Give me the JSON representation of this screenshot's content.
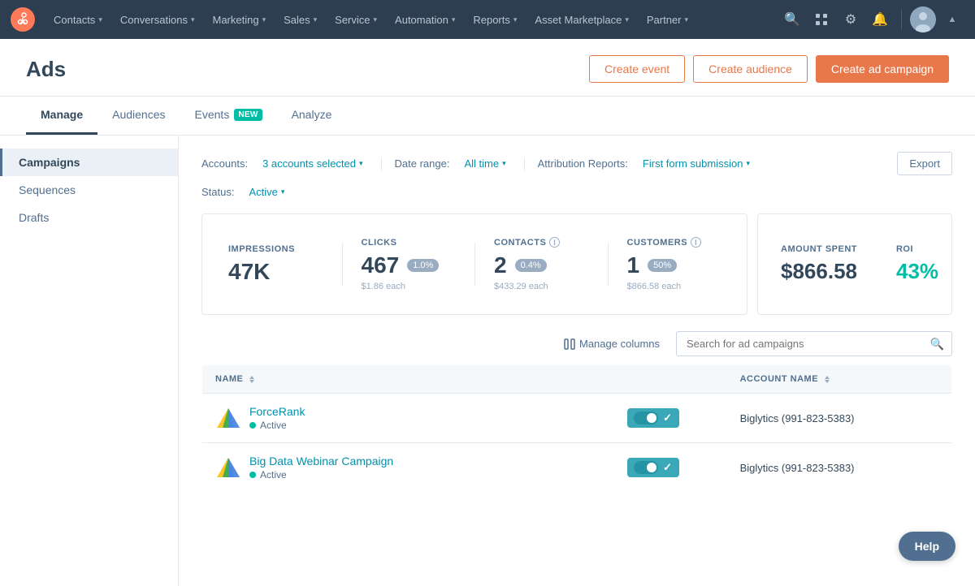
{
  "topnav": {
    "logo_label": "HubSpot",
    "items": [
      {
        "id": "contacts",
        "label": "Contacts",
        "has_dropdown": true
      },
      {
        "id": "conversations",
        "label": "Conversations",
        "has_dropdown": true
      },
      {
        "id": "marketing",
        "label": "Marketing",
        "has_dropdown": true
      },
      {
        "id": "sales",
        "label": "Sales",
        "has_dropdown": true
      },
      {
        "id": "service",
        "label": "Service",
        "has_dropdown": true
      },
      {
        "id": "automation",
        "label": "Automation",
        "has_dropdown": true
      },
      {
        "id": "reports",
        "label": "Reports",
        "has_dropdown": true
      },
      {
        "id": "asset_marketplace",
        "label": "Asset Marketplace",
        "has_dropdown": true
      },
      {
        "id": "partner",
        "label": "Partner",
        "has_dropdown": true
      }
    ]
  },
  "page": {
    "title": "Ads",
    "tabs": [
      {
        "id": "manage",
        "label": "Manage",
        "active": true,
        "badge": null
      },
      {
        "id": "audiences",
        "label": "Audiences",
        "active": false,
        "badge": null
      },
      {
        "id": "events",
        "label": "Events",
        "active": false,
        "badge": "NEW"
      },
      {
        "id": "analyze",
        "label": "Analyze",
        "active": false,
        "badge": null
      }
    ],
    "buttons": {
      "create_event": "Create event",
      "create_audience": "Create audience",
      "create_ad_campaign": "Create ad campaign"
    }
  },
  "sidebar": {
    "items": [
      {
        "id": "campaigns",
        "label": "Campaigns",
        "active": true
      },
      {
        "id": "sequences",
        "label": "Sequences",
        "active": false
      },
      {
        "id": "drafts",
        "label": "Drafts",
        "active": false
      }
    ]
  },
  "filters": {
    "accounts_label": "Accounts:",
    "accounts_value": "3 accounts selected",
    "date_range_label": "Date range:",
    "date_range_value": "All time",
    "attribution_label": "Attribution Reports:",
    "attribution_value": "First form submission",
    "status_label": "Status:",
    "status_value": "Active",
    "export_label": "Export"
  },
  "metrics": {
    "impressions": {
      "label": "IMPRESSIONS",
      "value": "47K",
      "has_info": false,
      "pct": null,
      "sub": null
    },
    "clicks": {
      "label": "CLICKS",
      "value": "467",
      "has_info": false,
      "pct": "1.0%",
      "sub": "$1.86 each"
    },
    "contacts": {
      "label": "CONTACTS",
      "value": "2",
      "has_info": true,
      "pct": "0.4%",
      "sub": "$433.29 each"
    },
    "customers": {
      "label": "CUSTOMERS",
      "value": "1",
      "has_info": true,
      "pct": "50%",
      "sub": "$866.58 each"
    },
    "amount_spent": {
      "label": "AMOUNT SPENT",
      "value": "$866.58"
    },
    "roi": {
      "label": "ROI",
      "value": "43%"
    }
  },
  "table": {
    "manage_columns_label": "Manage columns",
    "search_placeholder": "Search for ad campaigns",
    "columns": [
      {
        "id": "name",
        "label": "NAME",
        "sortable": true
      },
      {
        "id": "account_name",
        "label": "ACCOUNT NAME",
        "sortable": true
      }
    ],
    "rows": [
      {
        "id": "force-rank",
        "name": "ForceRank",
        "status": "Active",
        "account": "Biglytics (991-823-5383)",
        "toggle_on": true
      },
      {
        "id": "big-data-webinar",
        "name": "Big Data Webinar Campaign",
        "status": "Active",
        "account": "Biglytics (991-823-5383)",
        "toggle_on": true
      }
    ]
  },
  "help": {
    "label": "Help"
  }
}
